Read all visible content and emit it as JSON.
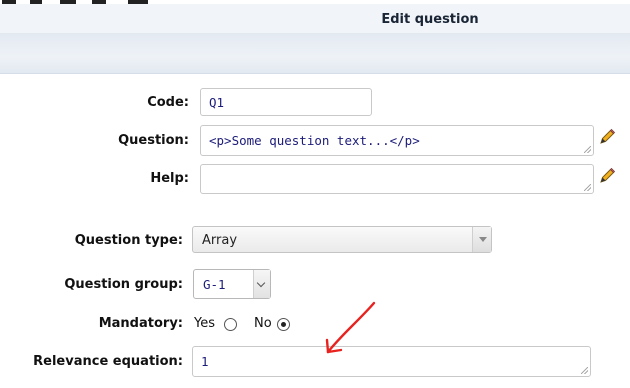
{
  "header": {
    "title": "Edit question"
  },
  "form": {
    "code": {
      "label": "Code:",
      "value": "Q1"
    },
    "question": {
      "label": "Question:",
      "value": "<p>Some question text...</p>"
    },
    "help": {
      "label": "Help:",
      "value": ""
    },
    "question_type": {
      "label": "Question type:",
      "selected": "Array"
    },
    "question_group": {
      "label": "Question group:",
      "selected": "G-1"
    },
    "mandatory": {
      "label": "Mandatory:",
      "yes_label": "Yes",
      "no_label": "No",
      "value": "No"
    },
    "relevance": {
      "label": "Relevance equation:",
      "value": "1"
    }
  },
  "icons": {
    "edit": "pencil-icon",
    "annotation": "red-arrow"
  },
  "colors": {
    "annotation": "#e8231f",
    "field_text": "#1c1c7a",
    "title_bar": "#f1f4f8"
  }
}
